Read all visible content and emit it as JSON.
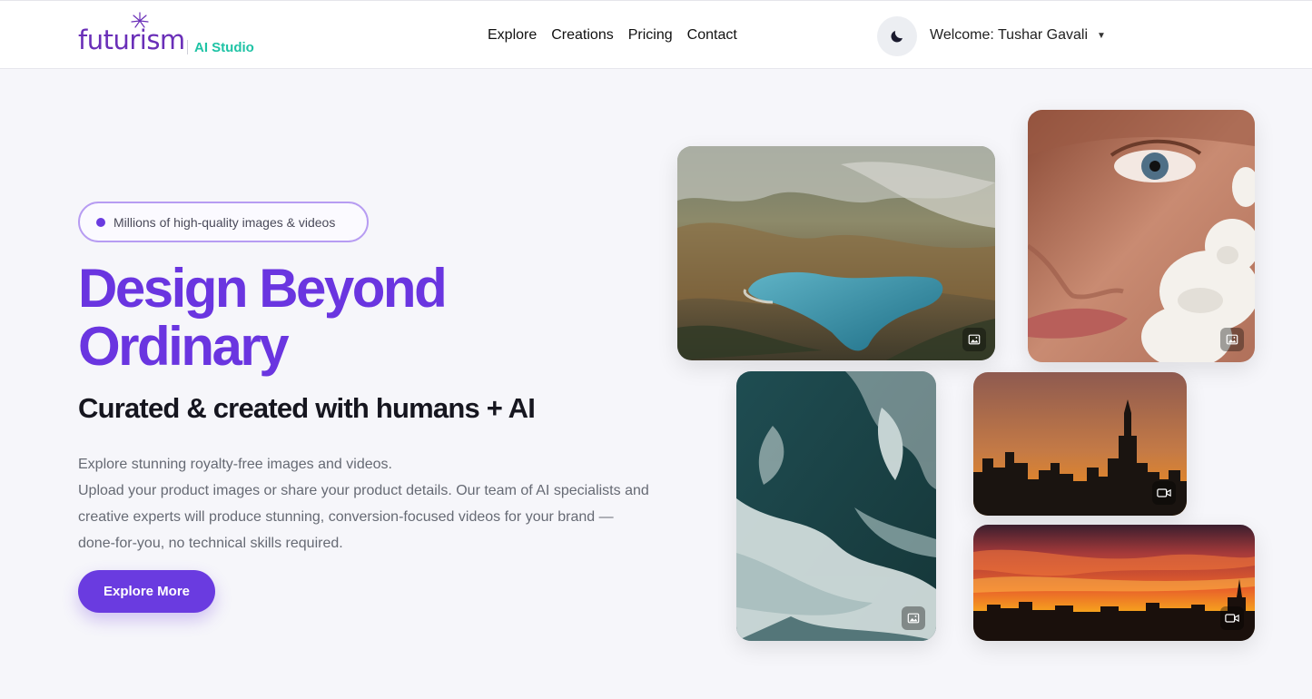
{
  "header": {
    "logo": {
      "word": "futurism",
      "sub": "AI Studio"
    },
    "nav": [
      {
        "label": "Explore"
      },
      {
        "label": "Creations"
      },
      {
        "label": "Pricing"
      },
      {
        "label": "Contact"
      }
    ],
    "theme_toggle_icon": "moon-icon",
    "welcome": "Welcome: Tushar Gavali",
    "welcome_caret": "▼"
  },
  "hero": {
    "badge": "Millions of high-quality images & videos",
    "title_line1": "Design Beyond",
    "title_line2": "Ordinary",
    "subtitle": "Curated & created with humans + AI",
    "desc_line1": "Explore stunning royalty-free images and videos.",
    "desc_line2": "Upload your product images or share your product details. Our team of AI specialists and creative experts will produce stunning, conversion-focused videos for your brand — done-for-you, no technical skills required.",
    "cta": "Explore More"
  },
  "gallery": [
    {
      "subject": "mountain lake aerial",
      "media": "image-icon"
    },
    {
      "subject": "woman face with white flowers",
      "media": "image-icon"
    },
    {
      "subject": "ocean waves aerial",
      "media": "image-icon"
    },
    {
      "subject": "city skyline silhouette at dusk",
      "media": "video-icon"
    },
    {
      "subject": "city skyline at sunset",
      "media": "video-icon"
    }
  ],
  "colors": {
    "brand_purple": "#6a35e0",
    "brand_teal": "#1fc3a5",
    "background": "#f6f6fa"
  }
}
